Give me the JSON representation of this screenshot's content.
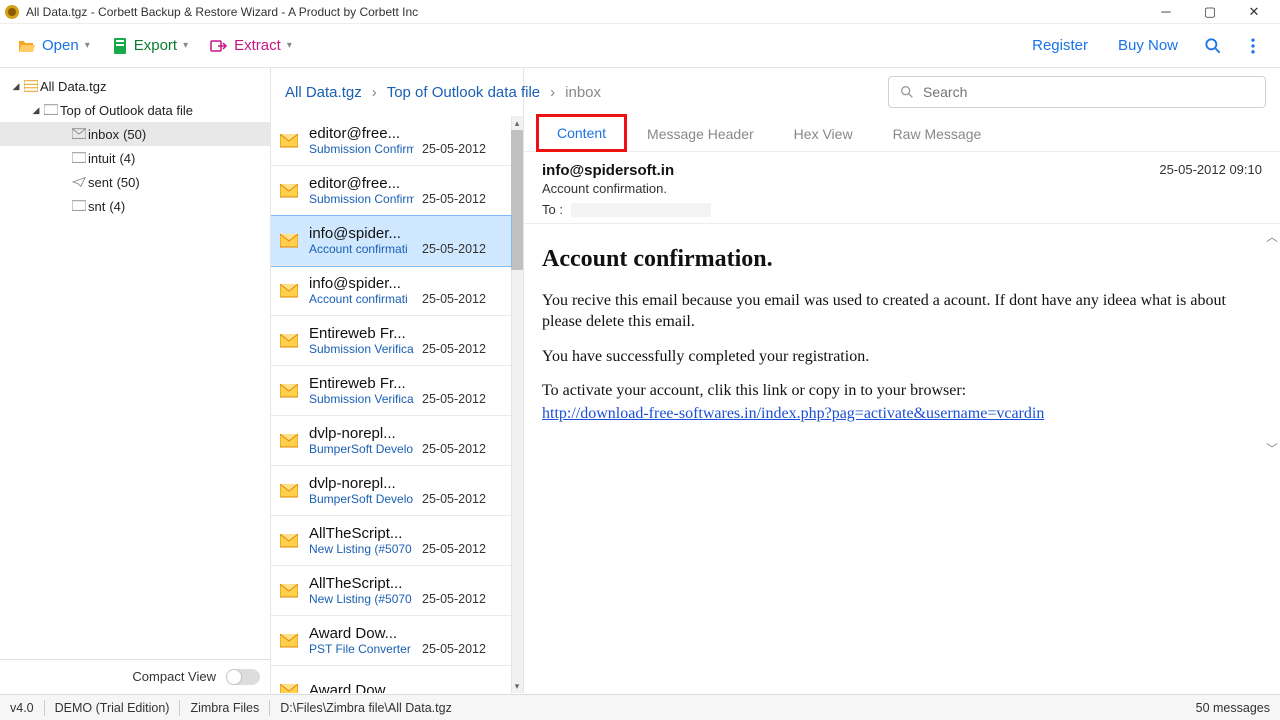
{
  "window": {
    "title": "All Data.tgz - Corbett Backup & Restore Wizard - A Product by Corbett Inc"
  },
  "toolbar": {
    "open": "Open",
    "export": "Export",
    "extract": "Extract",
    "register": "Register",
    "buy": "Buy Now"
  },
  "search": {
    "placeholder": "Search"
  },
  "breadcrumb": {
    "a": "All Data.tgz",
    "b": "Top of Outlook data file",
    "c": "inbox"
  },
  "tree": {
    "root": "All Data.tgz",
    "top": "Top of Outlook data file",
    "items": [
      {
        "label": "inbox",
        "count": "(50)"
      },
      {
        "label": "intuit",
        "count": "(4)"
      },
      {
        "label": "sent",
        "count": "(50)"
      },
      {
        "label": "snt",
        "count": "(4)"
      }
    ],
    "compact": "Compact View"
  },
  "messages": [
    {
      "from": "editor@free...",
      "subj": "Submission Confirm",
      "date": "25-05-2012"
    },
    {
      "from": "editor@free...",
      "subj": "Submission Confirm",
      "date": "25-05-2012"
    },
    {
      "from": "info@spider...",
      "subj": "Account confirmati",
      "date": "25-05-2012"
    },
    {
      "from": "info@spider...",
      "subj": "Account confirmati",
      "date": "25-05-2012"
    },
    {
      "from": "Entireweb Fr...",
      "subj": "Submission Verifica",
      "date": "25-05-2012"
    },
    {
      "from": "Entireweb Fr...",
      "subj": "Submission Verifica",
      "date": "25-05-2012"
    },
    {
      "from": "dvlp-norepl...",
      "subj": "BumperSoft Develo",
      "date": "25-05-2012"
    },
    {
      "from": "dvlp-norepl...",
      "subj": "BumperSoft Develo",
      "date": "25-05-2012"
    },
    {
      "from": "AllTheScript...",
      "subj": "New Listing (#5070",
      "date": "25-05-2012"
    },
    {
      "from": "AllTheScript...",
      "subj": "New Listing (#5070",
      "date": "25-05-2012"
    },
    {
      "from": "Award Dow...",
      "subj": "PST File Converter :",
      "date": "25-05-2012"
    },
    {
      "from": "Award Dow...",
      "subj": "",
      "date": ""
    }
  ],
  "tabs": {
    "content": "Content",
    "header": "Message Header",
    "hex": "Hex View",
    "raw": "Raw Message"
  },
  "preview": {
    "from": "info@spidersoft.in",
    "timestamp": "25-05-2012 09:10",
    "subject": "Account confirmation.",
    "to_label": "To :",
    "title": "Account confirmation.",
    "p1": "You recive this email because you email was used to created a acount. If dont have any ideea what is about please delete this email.",
    "p2": "You have successfully completed your registration.",
    "p3": "To activate your account, clik this link or copy in to your browser:",
    "link": "http://download-free-softwares.in/index.php?pag=activate&username=vcardin"
  },
  "status": {
    "version": "v4.0",
    "edition": "DEMO (Trial Edition)",
    "mode": "Zimbra Files",
    "path": "D:\\Files\\Zimbra file\\All Data.tgz",
    "count": "50  messages"
  }
}
